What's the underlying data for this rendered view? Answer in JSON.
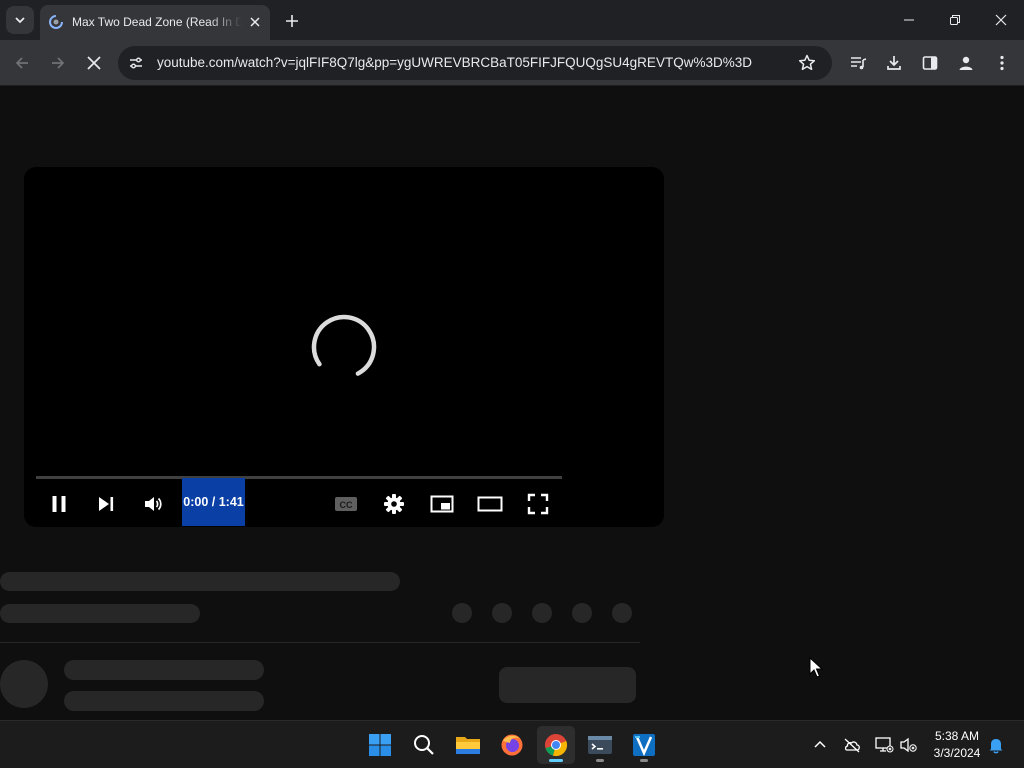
{
  "browser": {
    "tab": {
      "title": "Max Two Dead Zone (Read In Dark Mode) - YouTube"
    },
    "omnibox": {
      "url": "youtube.com/watch?v=jqlFIF8Q7lg&pp=ygUWREVBRCBaT05FIFJFQUQgSU4gREVTQw%3D%3D"
    }
  },
  "player": {
    "time_display": "0:00 / 1:41",
    "progress_fraction": 0.0,
    "state": "loading"
  },
  "taskbar": {
    "apps": [
      {
        "name": "start-icon",
        "running": false,
        "active": false
      },
      {
        "name": "search-icon",
        "running": false,
        "active": false
      },
      {
        "name": "file-explorer-icon",
        "running": false,
        "active": false
      },
      {
        "name": "firefox-icon",
        "running": false,
        "active": false
      },
      {
        "name": "chrome-icon",
        "running": true,
        "active": true
      },
      {
        "name": "terminal-icon",
        "running": true,
        "active": false
      },
      {
        "name": "visual-studio-icon",
        "running": true,
        "active": false
      }
    ],
    "clock": {
      "time": "5:38 AM",
      "date": "3/3/2024"
    }
  },
  "colors": {
    "accent_blue": "#0a3fa6",
    "taskbar_indicator": "#60cdff",
    "chrome_frame": "#202124",
    "chrome_toolbar": "#35363a",
    "page_background": "#0f0f0f",
    "skeleton": "#272727"
  }
}
